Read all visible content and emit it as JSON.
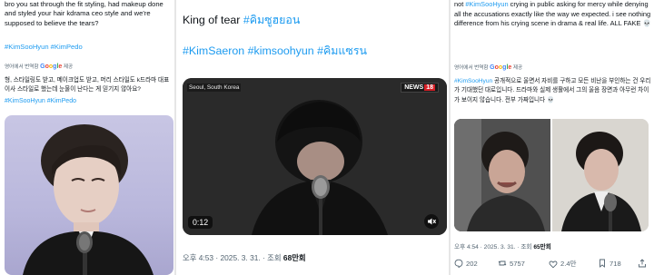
{
  "panel1": {
    "text": "bro you sat through the fit styling, had makeup done and styled your hair kdrama ceo style and we're supposed to believe the tears?",
    "hashtags": "#KimSooHyun #KimPedo",
    "translate_prefix": "영어에서 번역함",
    "translate_brand": "Google",
    "translate_suffix": "제공",
    "translation": "형, 스타일링도 받고, 메이크업도 받고, 머리 스타일도 k드라마 대표이사 스타일로 했는데 눈물이 난다는 게 믿기지 않아요?",
    "translation_hashtags": "#KimSooHyun #KimPedo"
  },
  "panel2": {
    "title_text": "King of tear ",
    "title_tag": "#คิมซูฮยอน",
    "hashtags": "#KimSaeron #kimsoohyun #คิมแซรน",
    "video_location": "Seoul, South Korea",
    "video_channel": "NEWS",
    "video_channel_num": "18",
    "video_duration": "0:12",
    "meta_time": "오후 4:53 · 2025. 3. 31. · 조회 ",
    "meta_views": "68만회"
  },
  "panel3": {
    "text_before": "not ",
    "text_tag": "#KimSooHyun",
    "text_after": " crying in public asking for mercy while denying all the accusations exactly like the way we expected. i see nothing difference from his crying scene in drama & real life. ALL FAKE 💀",
    "translate_prefix": "영어에서 번역함",
    "translate_brand": "Google",
    "translate_suffix": "제공",
    "translation_tag": "#KimSooHyun",
    "translation_text": " 공개적으로 울면서 자비를 구하고 모든 비난을 부인하는 건 우리가 기대했던 대로입니다. 드라마와 실제 생활에서 그의 울음 장면과 아무런 차이가 보이지 않습니다. 전부 가짜입니다 💀",
    "meta_time": "오후 4:54 · 2025. 3. 31. · 조회 ",
    "meta_views": "65만회",
    "actions": {
      "replies": "202",
      "retweets": "5757",
      "likes": "2.4만",
      "bookmarks": "718"
    }
  },
  "colors": {
    "link": "#1d9bf0",
    "muted": "#536471",
    "text": "#0f1419"
  }
}
